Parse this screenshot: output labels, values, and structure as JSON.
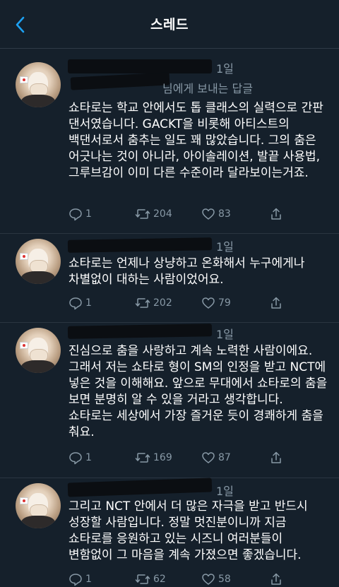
{
  "header": {
    "title": "스레드",
    "back_icon": "chevron-left-icon"
  },
  "tweets": [
    {
      "time": "1일",
      "reply_to": "님에게 보내는 답글",
      "text": "쇼타로는 학교 안에서도 톱 클래스의 실력으로 간판 댄서였습니다. GACKT을 비롯해 아티스트의 백댄서로서 춤추는 일도 꽤 많았습니다. 그의 춤은 어긋나는 것이 아니라, 아이솔레이션, 발끝 사용법, 그루브감이 이미 다른 수준이라 달라보이는거죠.",
      "replies": "1",
      "retweets": "204",
      "likes": "83"
    },
    {
      "time": "1일",
      "text": "쇼타로는 언제나 상냥하고 온화해서 누구에게나 차별없이 대하는 사람이었어요.",
      "replies": "1",
      "retweets": "202",
      "likes": "79"
    },
    {
      "time": "1일",
      "text": "진심으로 춤을 사랑하고 계속 노력한 사람이에요. 그래서 저는 쇼타로 형이 SM의 인정을 받고 NCT에 넣은 것을 이해해요. 앞으로 무대에서 쇼타로의 춤을 보면 분명히 알 수 있을 거라고 생각합니다. 쇼타로는 세상에서 가장 즐거운 듯이 경쾌하게 춤을 춰요.",
      "replies": "1",
      "retweets": "169",
      "likes": "87"
    },
    {
      "time": "1일",
      "text": "그리고 NCT 안에서 더 많은 자극을 받고 반드시 성장할 사람입니다. 정말 멋진분이니까 지금 쇼타로를 응원하고 있는 시즈니 여러분들이 변함없이 그 마음을 계속 가졌으면 좋겠습니다.",
      "replies": "1",
      "retweets": "62",
      "likes": "58"
    }
  ],
  "colors": {
    "background": "#15202b",
    "accent": "#1da1f2",
    "muted": "#8899a6"
  }
}
